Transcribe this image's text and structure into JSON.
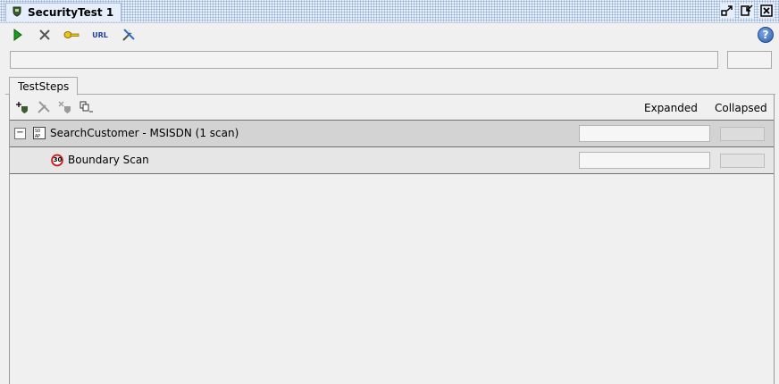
{
  "window": {
    "title": "SecurityTest 1",
    "title_icon": "security-test-icon",
    "controls": [
      "restore-icon",
      "minimize-to-dock-icon",
      "close-icon"
    ]
  },
  "toolbar": {
    "run": "run-icon",
    "cancel": "cancel-icon",
    "auth": "key-icon",
    "endpoint_label": "URL",
    "options": "options-icon",
    "help_glyph": "?"
  },
  "tabs": [
    {
      "label": "TestSteps",
      "selected": true
    }
  ],
  "steps_toolbar": {
    "icons": [
      "add-scan-icon",
      "configure-scan-icon",
      "remove-scan-icon",
      "clone-icon"
    ],
    "columns": {
      "expanded": "Expanded",
      "collapsed": "Collapsed"
    }
  },
  "steps": [
    {
      "label": "SearchCustomer - MSISDN (1 scan)",
      "icon": "soap-request-icon",
      "expanded": true,
      "expander_glyph": "−"
    },
    {
      "label": "Boundary Scan",
      "icon": "boundary-scan-icon",
      "badge": "30"
    }
  ],
  "colors": {
    "run_green": "#1a9a1a",
    "title_blue": "#8eaad3",
    "group_row": "#d3d3d3",
    "child_row": "#e6e6e6",
    "scan_red": "#d01c1c"
  }
}
